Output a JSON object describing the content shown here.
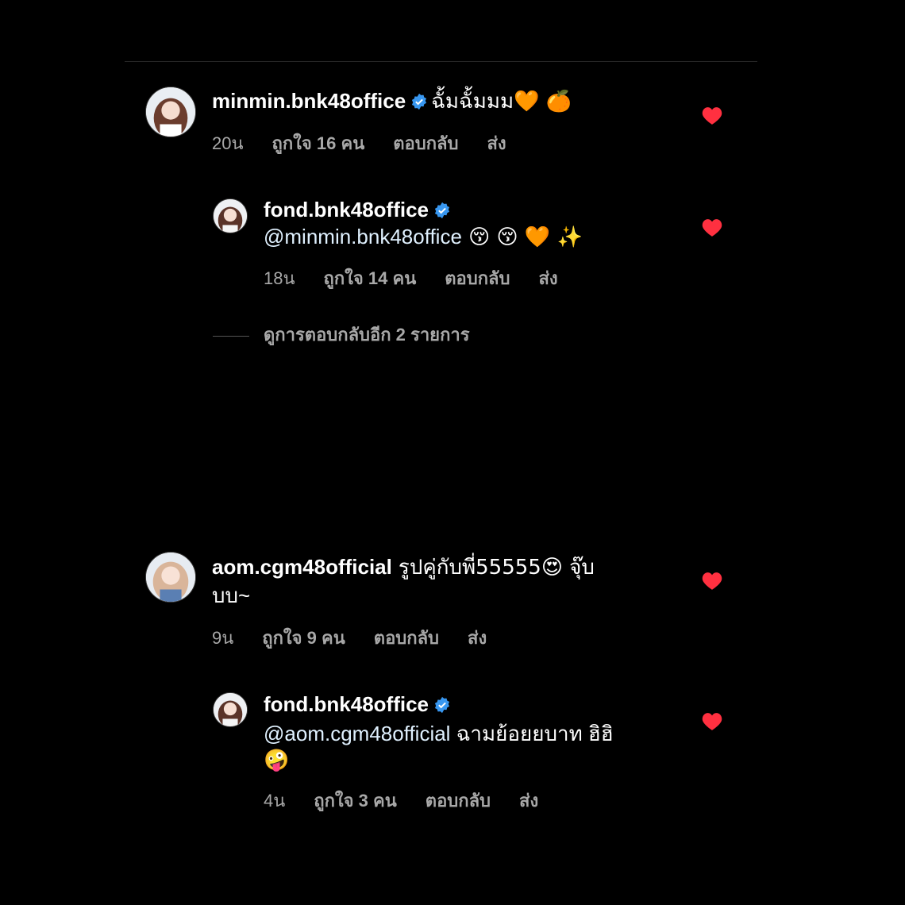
{
  "comments": [
    {
      "username": "minmin.bnk48office",
      "text": "ฉั้มฉั้มมม🧡 🍊",
      "time": "20น",
      "likes": "ถูกใจ 16 คน",
      "reply": "ตอบกลับ",
      "send": "ส่ง"
    },
    {
      "username": "fond.bnk48office",
      "mention": "@minmin.bnk48office",
      "text": " 😚 😚 🧡 ✨",
      "time": "18น",
      "likes": "ถูกใจ 14 คน",
      "reply": "ตอบกลับ",
      "send": "ส่ง"
    },
    {
      "username": "aom.cgm48official",
      "text": "รูปคู่กับพี่55555😍 จุ๊บ",
      "text2": "บบ~",
      "time": "9น",
      "likes": "ถูกใจ 9 คน",
      "reply": "ตอบกลับ",
      "send": "ส่ง"
    },
    {
      "username": "fond.bnk48office",
      "mention": "@aom.cgm48official",
      "text": " ฉามย้อยยบาท ฮิฮิ",
      "text2": "🤪",
      "time": "4น",
      "likes": "ถูกใจ 3 คน",
      "reply": "ตอบกลับ",
      "send": "ส่ง"
    }
  ],
  "view_replies": "ดูการตอบกลับอีก 2 รายการ",
  "colors": {
    "background": "#000000",
    "heart": "#ff3040",
    "verified": "#3897f0",
    "meta": "#a8a8a8"
  }
}
